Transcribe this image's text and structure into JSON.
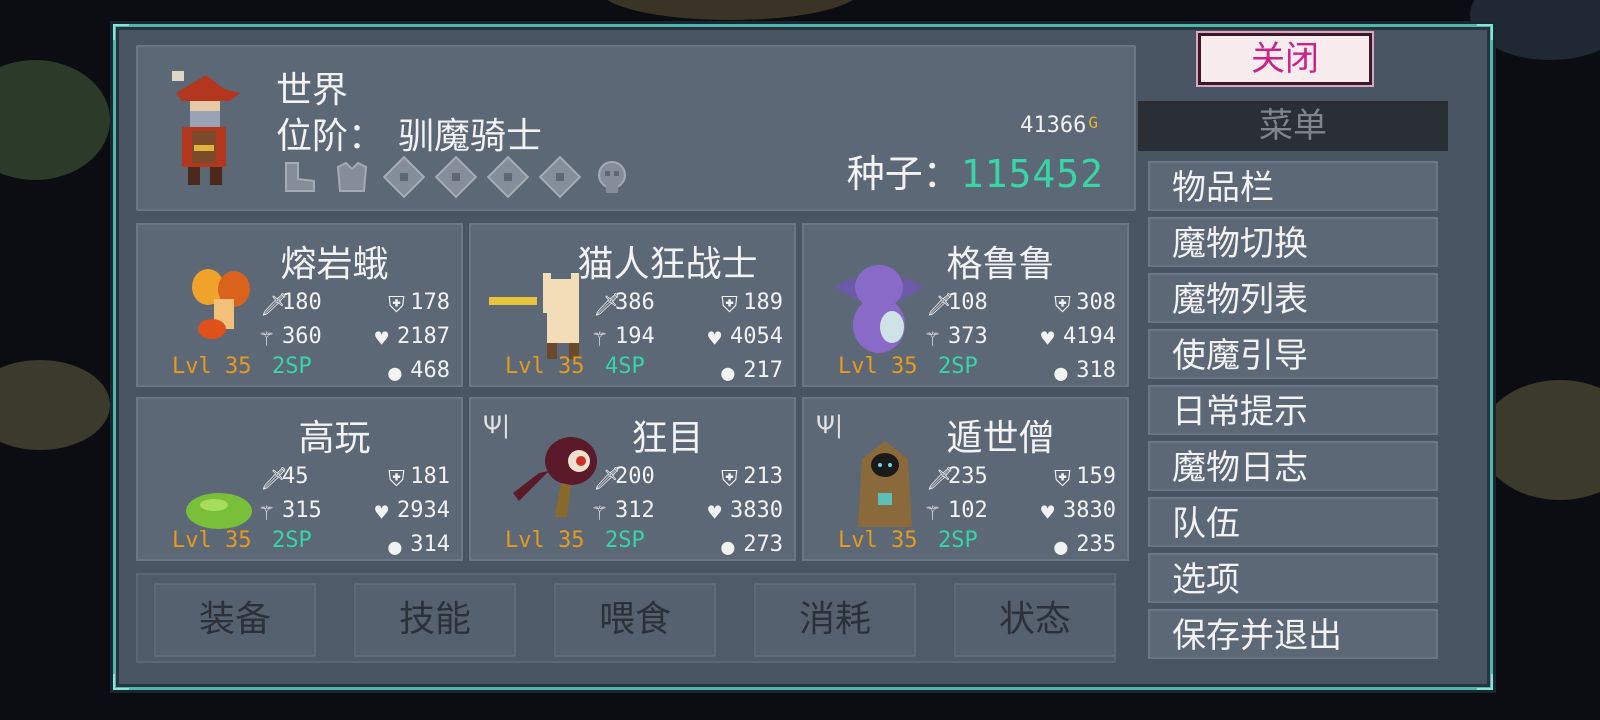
{
  "player": {
    "name": "世界",
    "rank_label": "位阶：",
    "rank": "驯魔骑士",
    "gold": "41366",
    "gold_unit": "G",
    "seed_label": "种子：",
    "seed_value": "115452",
    "equipment_slots": [
      "boot-icon",
      "armor-icon",
      "rune-slot-icon",
      "rune-slot-icon",
      "rune-slot-icon",
      "rune-slot-icon",
      "skull-icon"
    ]
  },
  "monsters": [
    {
      "name": "熔岩蛾",
      "atk": "180",
      "def": "178",
      "mag": "360",
      "hp": "2187",
      "level": "Lvl 35",
      "sp": "2SP",
      "food": "468",
      "fed": false
    },
    {
      "name": "猫人狂战士",
      "atk": "386",
      "def": "189",
      "mag": "194",
      "hp": "4054",
      "level": "Lvl 35",
      "sp": "4SP",
      "food": "217",
      "fed": false
    },
    {
      "name": "格鲁鲁",
      "atk": "108",
      "def": "308",
      "mag": "373",
      "hp": "4194",
      "level": "Lvl 35",
      "sp": "2SP",
      "food": "318",
      "fed": false
    },
    {
      "name": "高玩",
      "atk": "45",
      "def": "181",
      "mag": "315",
      "hp": "2934",
      "level": "Lvl 35",
      "sp": "2SP",
      "food": "314",
      "fed": false
    },
    {
      "name": "狂目",
      "atk": "200",
      "def": "213",
      "mag": "312",
      "hp": "3830",
      "level": "Lvl 35",
      "sp": "2SP",
      "food": "273",
      "fed": true
    },
    {
      "name": "遁世僧",
      "atk": "235",
      "def": "159",
      "mag": "102",
      "hp": "3830",
      "level": "Lvl 35",
      "sp": "2SP",
      "food": "235",
      "fed": true
    }
  ],
  "fork_glyph": "Ψ|",
  "actions": [
    "装备",
    "技能",
    "喂食",
    "消耗",
    "状态"
  ],
  "close_label": "关闭",
  "menu": {
    "title": "菜单",
    "items": [
      "物品栏",
      "魔物切换",
      "魔物列表",
      "使魔引导",
      "日常提示",
      "魔物日志",
      "队伍",
      "选项",
      "保存并退出"
    ]
  },
  "colors": {
    "frame": "#4fb8ad",
    "level": "#e89a1c",
    "sp": "#37d6a8",
    "seed": "#37d6a8",
    "close_text": "#cc2288"
  }
}
